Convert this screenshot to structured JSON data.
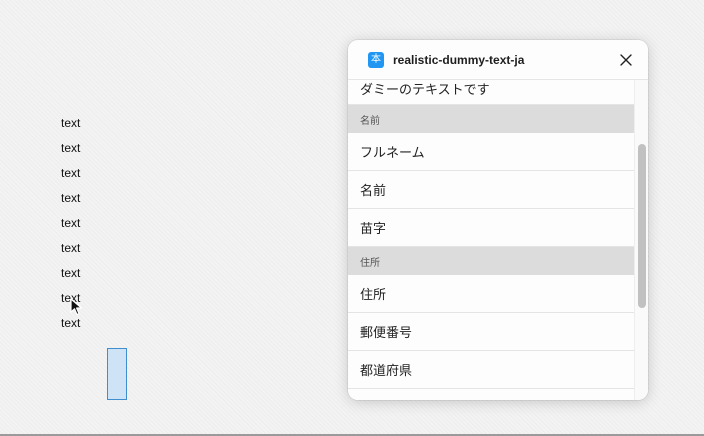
{
  "canvas": {
    "text_layers": [
      "text",
      "text",
      "text",
      "text",
      "text",
      "text",
      "text",
      "text",
      "text"
    ]
  },
  "plugin": {
    "title": "realistic-dummy-text-ja",
    "logo_glyph": "本",
    "close_icon": "close-icon",
    "accent_color": "#2196f3",
    "list": [
      {
        "type": "item",
        "label": "ダミーのテキストです"
      },
      {
        "type": "section",
        "label": "名前"
      },
      {
        "type": "item",
        "label": "フルネーム"
      },
      {
        "type": "item",
        "label": "名前"
      },
      {
        "type": "item",
        "label": "苗字"
      },
      {
        "type": "section",
        "label": "住所"
      },
      {
        "type": "item",
        "label": "住所"
      },
      {
        "type": "item",
        "label": "郵便番号"
      },
      {
        "type": "item",
        "label": "都道府県"
      },
      {
        "type": "item",
        "label": ""
      }
    ]
  }
}
